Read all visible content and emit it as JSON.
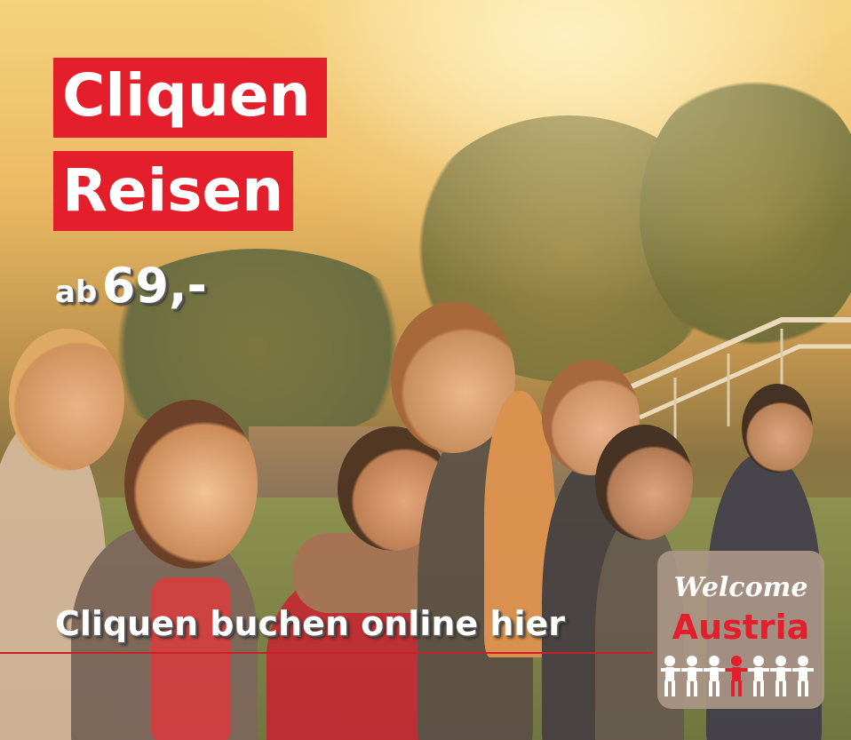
{
  "headline": {
    "line1": "Cliquen",
    "line2": "Reisen"
  },
  "price": {
    "prefix": "ab",
    "amount": "69,-"
  },
  "cta": {
    "label": "Cliquen buchen online hier"
  },
  "badge": {
    "welcome": "Welcome",
    "country": "Austria",
    "icon": "people-chain-icon"
  },
  "colors": {
    "accent_red": "#e41e2b",
    "badge_bg": "#a89688"
  }
}
